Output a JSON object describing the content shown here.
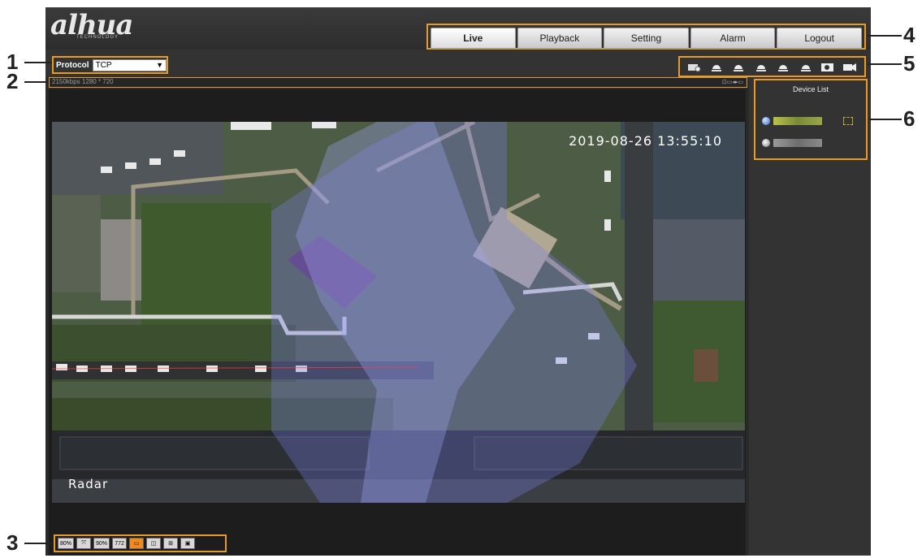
{
  "brand": {
    "logo": "alhua",
    "sub": "TECHNOLOGY"
  },
  "nav": {
    "tabs": [
      {
        "label": "Live",
        "active": true
      },
      {
        "label": "Playback"
      },
      {
        "label": "Setting"
      },
      {
        "label": "Alarm"
      },
      {
        "label": "Logout"
      }
    ]
  },
  "protocol": {
    "label": "Protocol",
    "value": "TCP"
  },
  "stream": {
    "info": "2150kbps 1280 * 720"
  },
  "video": {
    "timestamp": "2019-08-26 13:55:10",
    "channel_label": "Radar"
  },
  "layout_tools": [
    {
      "label": "80%"
    },
    {
      "label": "",
      "icon": "fit-icon"
    },
    {
      "label": "90%"
    },
    {
      "label": "772"
    },
    {
      "label": "",
      "icon": "single-view-icon",
      "active": true
    },
    {
      "label": "",
      "icon": "split-2-icon"
    },
    {
      "label": "",
      "icon": "split-4-icon"
    },
    {
      "label": "",
      "icon": "fullscreen-icon"
    }
  ],
  "view_tools": [
    "ptz-icon",
    "ptz-preset-1-icon",
    "ptz-preset-2-icon",
    "ptz-preset-3-icon",
    "ptz-preset-4-icon",
    "ptz-preset-5-icon",
    "snapshot-icon",
    "record-icon"
  ],
  "device_list": {
    "title": "Device List"
  },
  "callouts": [
    "1",
    "2",
    "3",
    "4",
    "5",
    "6"
  ],
  "colors": {
    "accent": "#e79b26",
    "overlay": "#7a7fe8"
  }
}
